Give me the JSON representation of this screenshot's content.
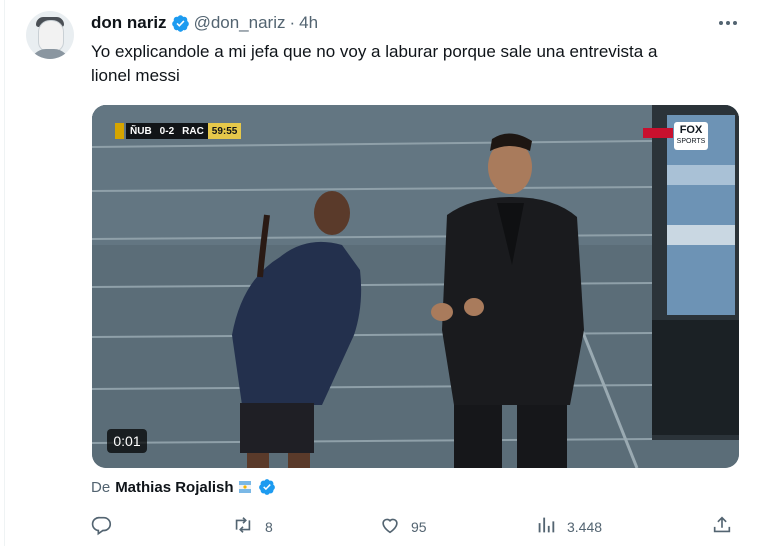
{
  "tweet": {
    "author_name": "don nariz",
    "handle": "@don_nariz",
    "separator": "·",
    "time": "4h",
    "text": "Yo explicandole a mi jefa que no voy a laburar porque sale una entrevista a\nlionel messi"
  },
  "media": {
    "video_time": "0:01",
    "scorebug": {
      "home": "ÑUB",
      "score": "0-2",
      "away": "RAC",
      "clock": "59:55"
    },
    "broadcaster_logo": "FOX",
    "broadcaster_sub": "SPORTS"
  },
  "attribution": {
    "prefix": "De",
    "author": "Mathias Rojalish"
  },
  "actions": {
    "replies": "",
    "retweets": "8",
    "likes": "95",
    "views": "3.448"
  },
  "colors": {
    "verified": "#1d9bf0",
    "secondary_text": "#536471",
    "primary_text": "#0f1419"
  },
  "icons": [
    "verified-badge-icon",
    "more-icon",
    "reply-icon",
    "retweet-icon",
    "like-icon",
    "views-icon",
    "share-icon"
  ]
}
